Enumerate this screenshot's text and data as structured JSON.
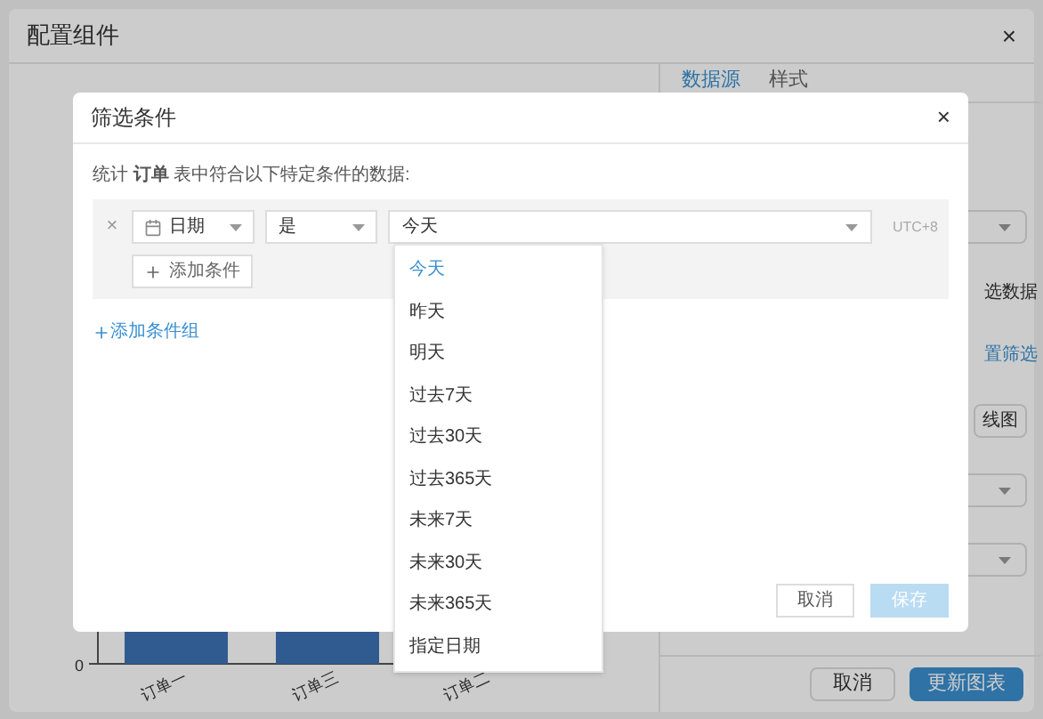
{
  "outer_dialog": {
    "title": "配置组件",
    "close": "×"
  },
  "chart": {
    "y_tick": "0",
    "x_labels": [
      "订单一",
      "订单三",
      "订单二"
    ]
  },
  "side_panel": {
    "tabs": [
      {
        "label": "数据源",
        "selected": true
      },
      {
        "label": "样式",
        "selected": false
      }
    ],
    "items": [
      {
        "kind": "select"
      },
      {
        "kind": "text",
        "label": "选数据"
      },
      {
        "kind": "link",
        "label": "置筛选"
      },
      {
        "kind": "button",
        "label": "线图"
      },
      {
        "kind": "select"
      },
      {
        "kind": "select"
      }
    ]
  },
  "footer": {
    "buttons": [
      {
        "label": "取消",
        "primary": false
      },
      {
        "label": "更新图表",
        "primary": true
      }
    ]
  },
  "modal": {
    "title": "筛选条件",
    "close": "×",
    "intro": "统计 **订单** 表中符合以下特定条件的数据:",
    "condition": {
      "remove": "×",
      "field": "日期",
      "operator": "是",
      "value": "今天",
      "timezone": "UTC+8",
      "add_condition": "添加条件"
    },
    "add_group": "添加条件组",
    "buttons": [
      {
        "label": "取消",
        "primary": false,
        "disabled": false
      },
      {
        "label": "保存",
        "primary": true,
        "disabled": true
      }
    ]
  },
  "dropdown": {
    "options": [
      {
        "label": "今天",
        "selected": true
      },
      {
        "label": "昨天",
        "selected": false
      },
      {
        "label": "明天",
        "selected": false
      },
      {
        "label": "过去7天",
        "selected": false
      },
      {
        "label": "过去30天",
        "selected": false
      },
      {
        "label": "过去365天",
        "selected": false
      },
      {
        "label": "未来7天",
        "selected": false
      },
      {
        "label": "未来30天",
        "selected": false
      },
      {
        "label": "未来365天",
        "selected": false
      },
      {
        "label": "指定日期",
        "selected": false
      }
    ]
  }
}
